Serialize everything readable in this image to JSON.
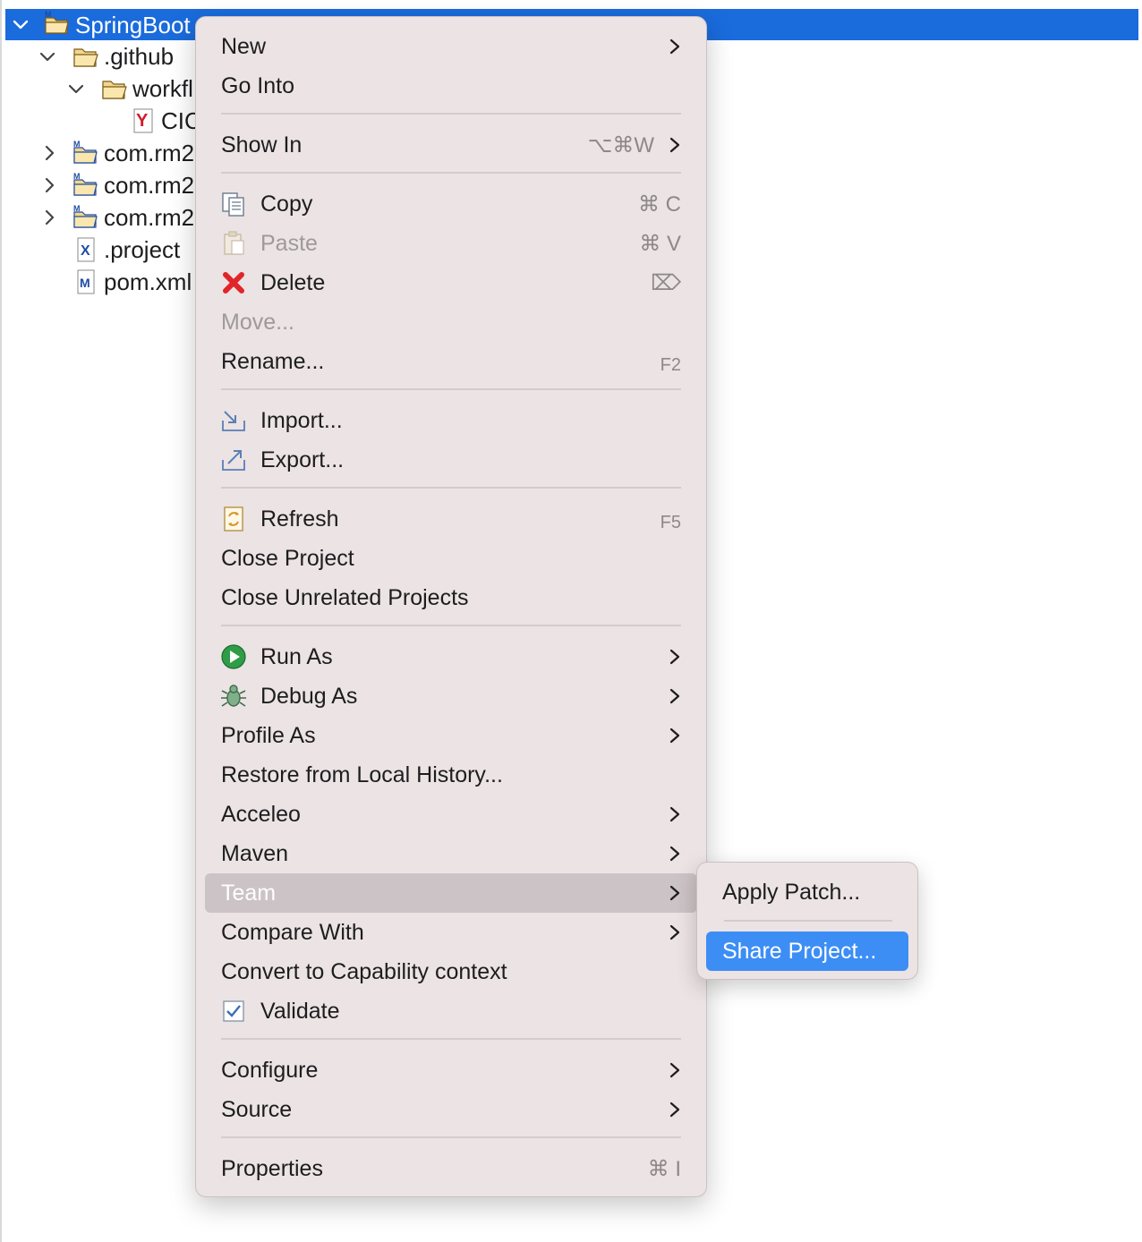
{
  "tree": {
    "items": [
      {
        "label": "SpringBoot",
        "expanded": true,
        "selected": true
      },
      {
        "label": ".github",
        "expanded": true
      },
      {
        "label": "workfl",
        "expanded": true
      },
      {
        "label": "CIC"
      },
      {
        "label": "com.rm2",
        "expanded": false
      },
      {
        "label": "com.rm2",
        "expanded": false
      },
      {
        "label": "com.rm2",
        "expanded": false
      },
      {
        "label": ".project"
      },
      {
        "label": "pom.xml"
      }
    ]
  },
  "context_menu": {
    "new": "New",
    "go_into": "Go Into",
    "show_in": "Show In",
    "show_in_shortcut": "⌥⌘W",
    "copy": "Copy",
    "copy_shortcut": "⌘ C",
    "paste": "Paste",
    "paste_shortcut": "⌘ V",
    "delete": "Delete",
    "delete_shortcut": "⌦",
    "move": "Move...",
    "rename": "Rename...",
    "rename_shortcut": "F2",
    "import": "Import...",
    "export": "Export...",
    "refresh": "Refresh",
    "refresh_shortcut": "F5",
    "close_project": "Close Project",
    "close_unrelated": "Close Unrelated Projects",
    "run_as": "Run As",
    "debug_as": "Debug As",
    "profile_as": "Profile As",
    "restore_history": "Restore from Local History...",
    "acceleo": "Acceleo",
    "maven": "Maven",
    "team": "Team",
    "compare_with": "Compare With",
    "convert_capability": "Convert to Capability context",
    "validate": "Validate",
    "configure": "Configure",
    "source": "Source",
    "properties": "Properties",
    "properties_shortcut": "⌘ I"
  },
  "team_submenu": {
    "apply_patch": "Apply Patch...",
    "share_project": "Share Project..."
  },
  "colors": {
    "selection": "#1a6bdc",
    "menu_bg": "#ebe3e4",
    "menu_highlight": "#cbc3c5",
    "submenu_selected": "#3c8ef5"
  }
}
